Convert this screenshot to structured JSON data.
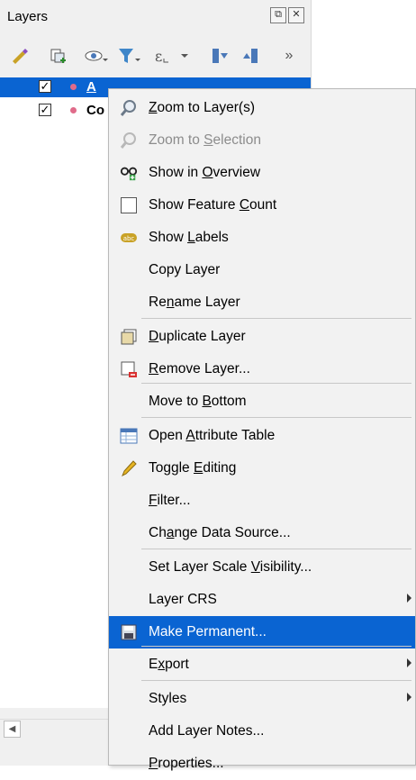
{
  "panel": {
    "title": "Layers",
    "toolbar_more": "»",
    "buttons": {
      "float": "⧉",
      "close": "✕"
    }
  },
  "layers": [
    {
      "name": "A",
      "checked": true,
      "selected": true,
      "dot_color": "#e06b8a"
    },
    {
      "name": "Co",
      "checked": true,
      "selected": false,
      "dot_color": "#e06b8a"
    }
  ],
  "menu": {
    "items": [
      {
        "pre": "",
        "u": "Z",
        "post": "oom to Layer(s)",
        "icon": "zoom-layer-icon"
      },
      {
        "pre": "Zoom to ",
        "u": "S",
        "post": "election",
        "icon": "zoom-selection-icon",
        "disabled": true
      },
      {
        "pre": "Show in ",
        "u": "O",
        "post": "verview",
        "icon": "overview-icon"
      },
      {
        "pre": "Show Feature ",
        "u": "C",
        "post": "ount",
        "icon": "checkbox-icon"
      },
      {
        "pre": "Show ",
        "u": "L",
        "post": "abels",
        "icon": "labels-icon"
      },
      {
        "pre": "Copy Layer",
        "u": "",
        "post": ""
      },
      {
        "pre": "Re",
        "u": "n",
        "post": "ame Layer"
      },
      {
        "pre": "",
        "u": "D",
        "post": "uplicate Layer",
        "icon": "duplicate-layer-icon"
      },
      {
        "pre": "",
        "u": "R",
        "post": "emove Layer...",
        "icon": "remove-layer-icon"
      },
      {
        "pre": "Move to ",
        "u": "B",
        "post": "ottom"
      },
      {
        "pre": "Open ",
        "u": "A",
        "post": "ttribute Table",
        "icon": "attribute-table-icon"
      },
      {
        "pre": "Toggle ",
        "u": "E",
        "post": "diting",
        "icon": "pencil-icon"
      },
      {
        "pre": "",
        "u": "F",
        "post": "ilter..."
      },
      {
        "pre": "Ch",
        "u": "a",
        "post": "nge Data Source..."
      },
      {
        "pre": "Set Layer Scale ",
        "u": "V",
        "post": "isibility..."
      },
      {
        "pre": "Layer CRS",
        "u": "",
        "post": "",
        "submenu": true
      },
      {
        "pre": "Make Permanent...",
        "u": "",
        "post": "",
        "icon": "save-icon",
        "highlighted": true
      },
      {
        "pre": "E",
        "u": "x",
        "post": "port",
        "submenu": true
      },
      {
        "pre": "Styles",
        "u": "",
        "post": "",
        "submenu": true
      },
      {
        "pre": "Add Layer Notes...",
        "u": "",
        "post": ""
      },
      {
        "pre": "",
        "u": "P",
        "post": "roperties..."
      }
    ]
  },
  "colors": {
    "highlight": "#0a64d2",
    "disabled_text": "#8c8c8c"
  }
}
